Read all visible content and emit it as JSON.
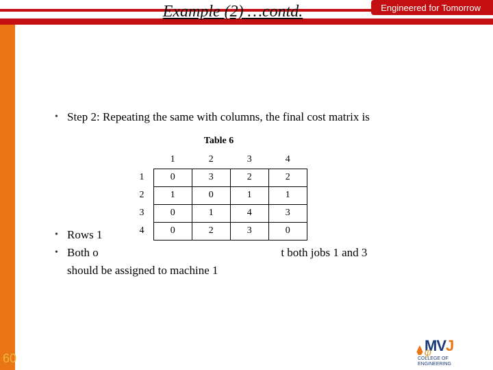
{
  "header": {
    "tagline": "Engineered for Tomorrow"
  },
  "title": "Example (2) …contd.",
  "bullets": {
    "b1": "Step 2: Repeating the same with columns, the final cost matrix is",
    "b2_visible": "Rows 1",
    "b3_visible_left": "Both o",
    "b3_visible_right": "t both jobs 1 and 3",
    "b3_cont": "should be assigned to machine 1"
  },
  "table": {
    "caption": "Table 6",
    "col_headers": [
      "1",
      "2",
      "3",
      "4"
    ],
    "rows": [
      {
        "label": "1",
        "cells": [
          "0",
          "3",
          "2",
          "2"
        ]
      },
      {
        "label": "2",
        "cells": [
          "1",
          "0",
          "1",
          "1"
        ]
      },
      {
        "label": "3",
        "cells": [
          "0",
          "1",
          "4",
          "3"
        ]
      },
      {
        "label": "4",
        "cells": [
          "0",
          "2",
          "3",
          "0"
        ]
      }
    ]
  },
  "footer": {
    "page_number": "60",
    "logo_text": "MVJ",
    "logo_sub1": "COLLEGE OF",
    "logo_sub2": "ENGINEERING",
    "glyph": "φ"
  },
  "chart_data": {
    "type": "table",
    "title": "Table 6",
    "columns": [
      "",
      "1",
      "2",
      "3",
      "4"
    ],
    "rows": [
      [
        "1",
        0,
        3,
        2,
        2
      ],
      [
        "2",
        1,
        0,
        1,
        1
      ],
      [
        "3",
        0,
        1,
        4,
        3
      ],
      [
        "4",
        0,
        2,
        3,
        0
      ]
    ]
  }
}
